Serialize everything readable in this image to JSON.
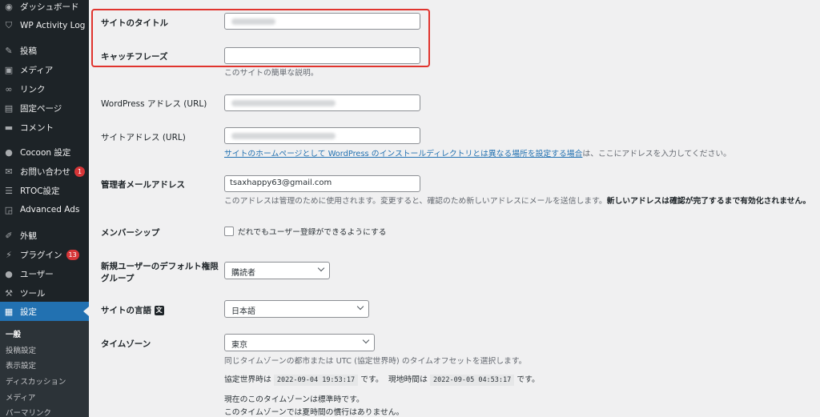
{
  "sidebar": {
    "items": [
      {
        "label": "ダッシュボード",
        "icon": "dashboard-icon"
      },
      {
        "label": "WP Activity Log",
        "icon": "shield-icon"
      },
      {
        "label": "投稿",
        "icon": "pin-icon"
      },
      {
        "label": "メディア",
        "icon": "media-icon"
      },
      {
        "label": "リンク",
        "icon": "link-icon"
      },
      {
        "label": "固定ページ",
        "icon": "page-icon"
      },
      {
        "label": "コメント",
        "icon": "comment-icon"
      },
      {
        "label": "Cocoon 設定",
        "icon": "cocoon-icon"
      },
      {
        "label": "お問い合わせ",
        "icon": "mail-icon",
        "badge": "1"
      },
      {
        "label": "RTOC設定",
        "icon": "list-icon"
      },
      {
        "label": "Advanced Ads",
        "icon": "ads-icon"
      },
      {
        "label": "外観",
        "icon": "brush-icon"
      },
      {
        "label": "プラグイン",
        "icon": "plugin-icon",
        "badge": "13"
      },
      {
        "label": "ユーザー",
        "icon": "user-icon"
      },
      {
        "label": "ツール",
        "icon": "wrench-icon"
      },
      {
        "label": "設定",
        "icon": "settings-icon"
      }
    ],
    "submenu": [
      "一般",
      "投稿設定",
      "表示設定",
      "ディスカッション",
      "メディア",
      "パーマリンク"
    ]
  },
  "form": {
    "site_title_label": "サイトのタイトル",
    "tagline_label": "キャッチフレーズ",
    "tagline_desc": "このサイトの簡単な説明。",
    "wp_address_label": "WordPress アドレス (URL)",
    "site_address_label": "サイトアドレス (URL)",
    "site_address_link": "サイトのホームページとして WordPress のインストールディレクトリとは異なる場所を設定する場合",
    "site_address_suffix": "は、ここにアドレスを入力してください。",
    "admin_email_label": "管理者メールアドレス",
    "admin_email_value": "tsaxhappy63@gmail.com",
    "admin_email_desc": "このアドレスは管理のために使用されます。変更すると、確認のため新しいアドレスにメールを送信します。",
    "admin_email_desc_bold": "新しいアドレスは確認が完了するまで有効化されません。",
    "membership_label": "メンバーシップ",
    "membership_checkbox": "だれでもユーザー登録ができるようにする",
    "default_role_label_1": "新規ユーザーのデフォルト権限",
    "default_role_label_2": "グループ",
    "default_role_value": "購読者",
    "language_label": "サイトの言語",
    "language_value": "日本語",
    "timezone_label": "タイムゾーン",
    "timezone_value": "東京",
    "timezone_desc": "同じタイムゾーンの都市または UTC (協定世界時) のタイムオフセットを選択します。",
    "utc_label": "協定世界時は",
    "utc_value": "2022-09-04 19:53:17",
    "utc_suffix": "です。",
    "local_label": "現地時間は",
    "local_value": "2022-09-05 04:53:17",
    "local_suffix": "です。",
    "std_time": "現在のこのタイムゾーンは標準時です。",
    "dst_note": "このタイムゾーンでは夏時間の慣行はありません。"
  },
  "colors": {
    "sidebar_bg": "#1d2327",
    "active_bg": "#2271b1",
    "highlight_border": "#e0342e",
    "link": "#2271b1"
  }
}
